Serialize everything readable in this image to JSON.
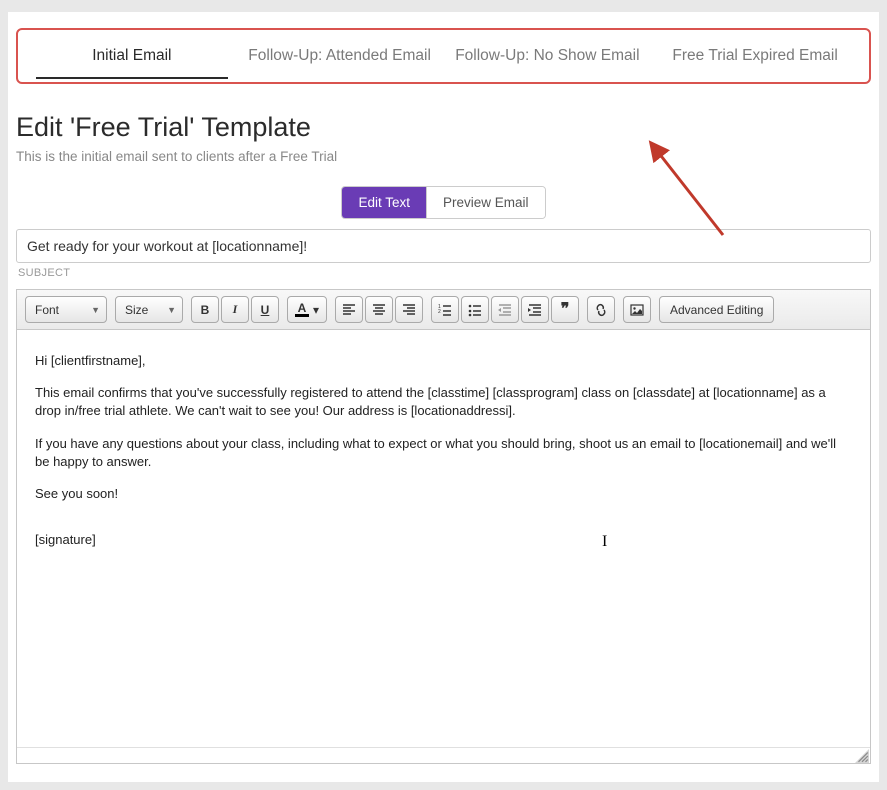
{
  "tabs": [
    {
      "label": "Initial Email",
      "active": true
    },
    {
      "label": "Follow-Up: Attended Email",
      "active": false
    },
    {
      "label": "Follow-Up: No Show Email",
      "active": false
    },
    {
      "label": "Free Trial Expired Email",
      "active": false
    }
  ],
  "page": {
    "title": "Edit 'Free Trial' Template",
    "subtitle": "This is the initial email sent to clients after a Free Trial"
  },
  "toggle": {
    "edit_label": "Edit Text",
    "preview_label": "Preview Email"
  },
  "subject": {
    "value": "Get ready for your workout at [locationname]!",
    "label": "SUBJECT"
  },
  "toolbar": {
    "font_label": "Font",
    "size_label": "Size",
    "advanced_label": "Advanced Editing"
  },
  "body": {
    "p1": "Hi [clientfirstname],",
    "p2": "This email confirms that you've successfully registered to attend the [classtime] [classprogram] class on [classdate] at [locationname] as a drop in/free trial athlete. We can't wait to see you! Our address is [locationaddressi].",
    "p3": "If you have any questions about your class, including what to expect or what you should bring, shoot us an email to [locationemail] and we'll be happy to answer.",
    "p4": "See you soon!",
    "p5": "[signature]"
  }
}
